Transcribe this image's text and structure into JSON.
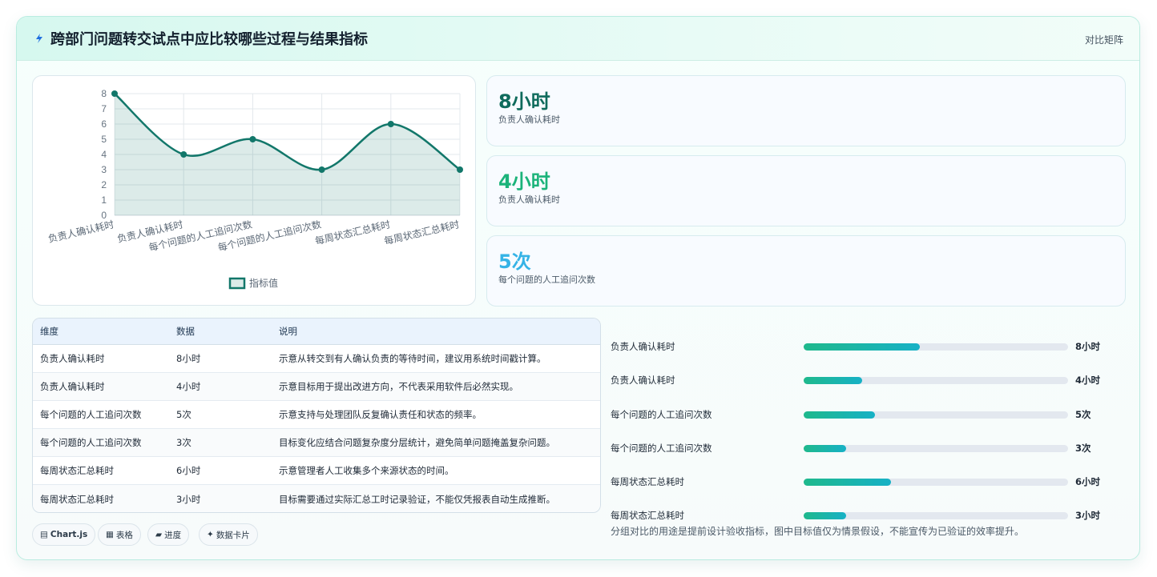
{
  "header": {
    "title": "跨部门问题转交试点中应比较哪些过程与结果指标",
    "action": "对比矩阵"
  },
  "chart_data": {
    "type": "line",
    "categories": [
      "负责人确认耗时",
      "负责人确认耗时",
      "每个问题的人工追问次数",
      "每个问题的人工追问次数",
      "每周状态汇总耗时",
      "每周状态汇总耗时"
    ],
    "series": [
      {
        "name": "指标值",
        "values": [
          8,
          4,
          5,
          3,
          6,
          3
        ]
      }
    ],
    "ylim": [
      0,
      8
    ],
    "yticks": [
      "0",
      "1",
      "2",
      "3",
      "4",
      "5",
      "6",
      "7",
      "8"
    ],
    "fill": true,
    "grid": true,
    "legend": "bottom",
    "color": "#12776a"
  },
  "stats": [
    {
      "value": "8小时",
      "label": "负责人确认耗时",
      "color": "#0f6b5c"
    },
    {
      "value": "4小时",
      "label": "负责人确认耗时",
      "color": "#1bb37a"
    },
    {
      "value": "5次",
      "label": "每个问题的人工追问次数",
      "color": "#35b3e6"
    }
  ],
  "table": {
    "headers": [
      "维度",
      "数据",
      "说明"
    ],
    "rows": [
      [
        "负责人确认耗时",
        "8小时",
        "示意从转交到有人确认负责的等待时间，建议用系统时间戳计算。"
      ],
      [
        "负责人确认耗时",
        "4小时",
        "示意目标用于提出改进方向，不代表采用软件后必然实现。"
      ],
      [
        "每个问题的人工追问次数",
        "5次",
        "示意支持与处理团队反复确认责任和状态的频率。"
      ],
      [
        "每个问题的人工追问次数",
        "3次",
        "目标变化应结合问题复杂度分层统计，避免简单问题掩盖复杂问题。"
      ],
      [
        "每周状态汇总耗时",
        "6小时",
        "示意管理者人工收集多个来源状态的时间。"
      ],
      [
        "每周状态汇总耗时",
        "3小时",
        "目标需要通过实际汇总工时记录验证，不能仅凭报表自动生成推断。"
      ]
    ]
  },
  "chips": [
    {
      "icon": "▤",
      "label": "Chart.js"
    },
    {
      "icon": "▦",
      "label": "表格"
    },
    {
      "icon": "▰",
      "label": "进度"
    },
    {
      "icon": "✦",
      "label": "数据卡片"
    }
  ],
  "progress": [
    {
      "name": "负责人确认耗时",
      "value": "8小时",
      "fraction": 0.44
    },
    {
      "name": "负责人确认耗时",
      "value": "4小时",
      "fraction": 0.22
    },
    {
      "name": "每个问题的人工追问次数",
      "value": "5次",
      "fraction": 0.27
    },
    {
      "name": "每个问题的人工追问次数",
      "value": "3次",
      "fraction": 0.16
    },
    {
      "name": "每周状态汇总耗时",
      "value": "6小时",
      "fraction": 0.33
    },
    {
      "name": "每周状态汇总耗时",
      "value": "3小时",
      "fraction": 0.16
    }
  ],
  "note": "分组对比的用途是提前设计验收指标，图中目标值仅为情景假设，不能宣传为已验证的效率提升。"
}
